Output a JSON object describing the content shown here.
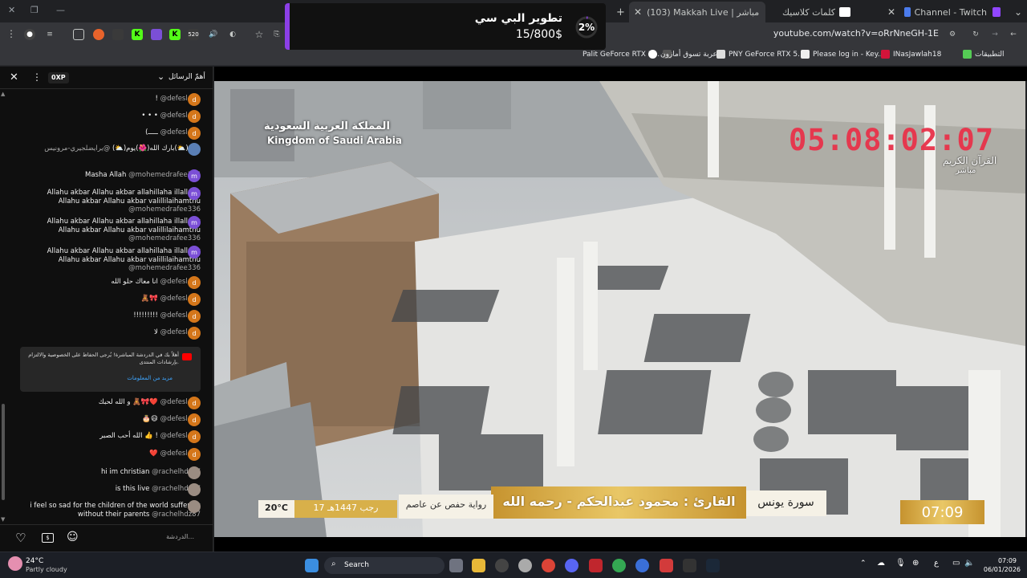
{
  "tabs": [
    {
      "label": "Channel - Twitch",
      "color": "#9146ff"
    },
    {
      "label": "كلمات كلاسيك",
      "color": "#ffffff"
    },
    {
      "label": "(103) Makkah Live | مباشر",
      "color": "#ff0000"
    }
  ],
  "toolbar": {
    "url": "youtube.com/watch?v=oRrNneGH-1E",
    "ext_badge": "520"
  },
  "bookmarks": [
    {
      "label": "التطبيقات"
    },
    {
      "label": "INasJawlah18"
    },
    {
      "label": "Please log in - Key..."
    },
    {
      "label": "PNY GeForce RTX 5..."
    },
    {
      "label": "عربة تسوق أمازون"
    },
    {
      "label": "Palit GeForce RTX 5..."
    }
  ],
  "popup": {
    "percent": "2%",
    "title": "تطوير البي سي",
    "progress_text": "15/800$",
    "progress_value": 0.02
  },
  "chat": {
    "title": "أهمّ الرسائل",
    "xp_badge": "0XP",
    "input_placeholder": "الدردشة...",
    "notice_text": "أهلاً بك في الدردشة المباشرة! يُرجى الحفاظ على الخصوصية والالتزام بإرشادات المنتدى.",
    "notice_link": "مزيد من المعلومات",
    "messages": [
      {
        "user": "@defesl-km",
        "text": "!",
        "avatar": "d",
        "color": "#d4761a"
      },
      {
        "user": "@defesl-km",
        "text": "• • •",
        "avatar": "d",
        "color": "#d4761a"
      },
      {
        "user": "@defesl-km",
        "text": "(ـــــ",
        "avatar": "d",
        "color": "#d4761a"
      },
      {
        "user": "@يرايضلجيري-مرونيس",
        "text": "صبح(⛅)بارك الله(🌺)يوم(⛅)",
        "avatar": "",
        "color": "#5a7fb5"
      },
      {
        "user": "@mohemedrafee336",
        "text": "Masha Allah",
        "avatar": "m",
        "color": "#7b4fd6"
      },
      {
        "user": "@mohemedrafee336",
        "text": "Allahu akbar Allahu akbar allahillaha illallahu Allahu akbar Allahu akbar valillilaihamthu",
        "avatar": "m",
        "color": "#7b4fd6"
      },
      {
        "user": "@mohemedrafee336",
        "text": "Allahu akbar Allahu akbar allahillaha illallahu Allahu akbar Allahu akbar valillilaihamthu",
        "avatar": "m",
        "color": "#7b4fd6"
      },
      {
        "user": "@mohemedrafee336",
        "text": "Allahu akbar Allahu akbar allahillaha illallahu Allahu akbar Allahu akbar valillilaihamthu",
        "avatar": "m",
        "color": "#7b4fd6"
      },
      {
        "user": "@defesl-km",
        "text": "انا معاك حلو الله",
        "avatar": "d",
        "color": "#d4761a"
      },
      {
        "user": "@defesl-km",
        "text": "🧸🎀",
        "avatar": "d",
        "color": "#d4761a"
      },
      {
        "user": "@defesl-km",
        "text": "!!!!!!!!!",
        "avatar": "d",
        "color": "#d4761a"
      },
      {
        "user": "@defesl-km",
        "text": "لا",
        "avatar": "d",
        "color": "#d4761a"
      },
      {
        "user": "@defesl-km",
        "text": "و الله لحبك 🧸🎀❤️",
        "avatar": "d",
        "color": "#d4761a"
      },
      {
        "user": "@defesl-km",
        "text": "🎂😄",
        "avatar": "d",
        "color": "#d4761a"
      },
      {
        "user": "@defesl-km",
        "text": "الله أحب الصبر 👍 !",
        "avatar": "d",
        "color": "#d4761a"
      },
      {
        "user": "@defesl-km",
        "text": "❤️",
        "avatar": "d",
        "color": "#d4761a"
      },
      {
        "user": "@rachelhdz87",
        "text": "hi im christian",
        "avatar": "",
        "color": "#9a8c82"
      },
      {
        "user": "@rachelhdz87",
        "text": "is this live",
        "avatar": "",
        "color": "#9a8c82"
      },
      {
        "user": "@rachelhdz87",
        "text": "i feel so sad for the children of the world suffering without their parents",
        "avatar": "",
        "color": "#9a8c82"
      }
    ]
  },
  "video": {
    "watermark_ar": "المملكة العربية السعودية",
    "watermark_en": "Kingdom of Saudi Arabia",
    "clock": "05:08:02:07",
    "channel_ar": "القرآن الكريم",
    "live_ar": "مباشر",
    "surah": "سورة يونس",
    "reciter": "القارئ : محمود عبدالحكم - رحمه الله",
    "riwaya": "رواية حفص عن عاصم",
    "hijri_date": "17 رجب 1447هـ",
    "temperature": "20°C",
    "time": "07:09"
  },
  "taskbar": {
    "weather_temp": "24°C",
    "weather_desc": "Partly cloudy",
    "search_label": "Search",
    "clock_time": "07:09",
    "clock_date": "06/01/2026",
    "lang": "ع"
  }
}
